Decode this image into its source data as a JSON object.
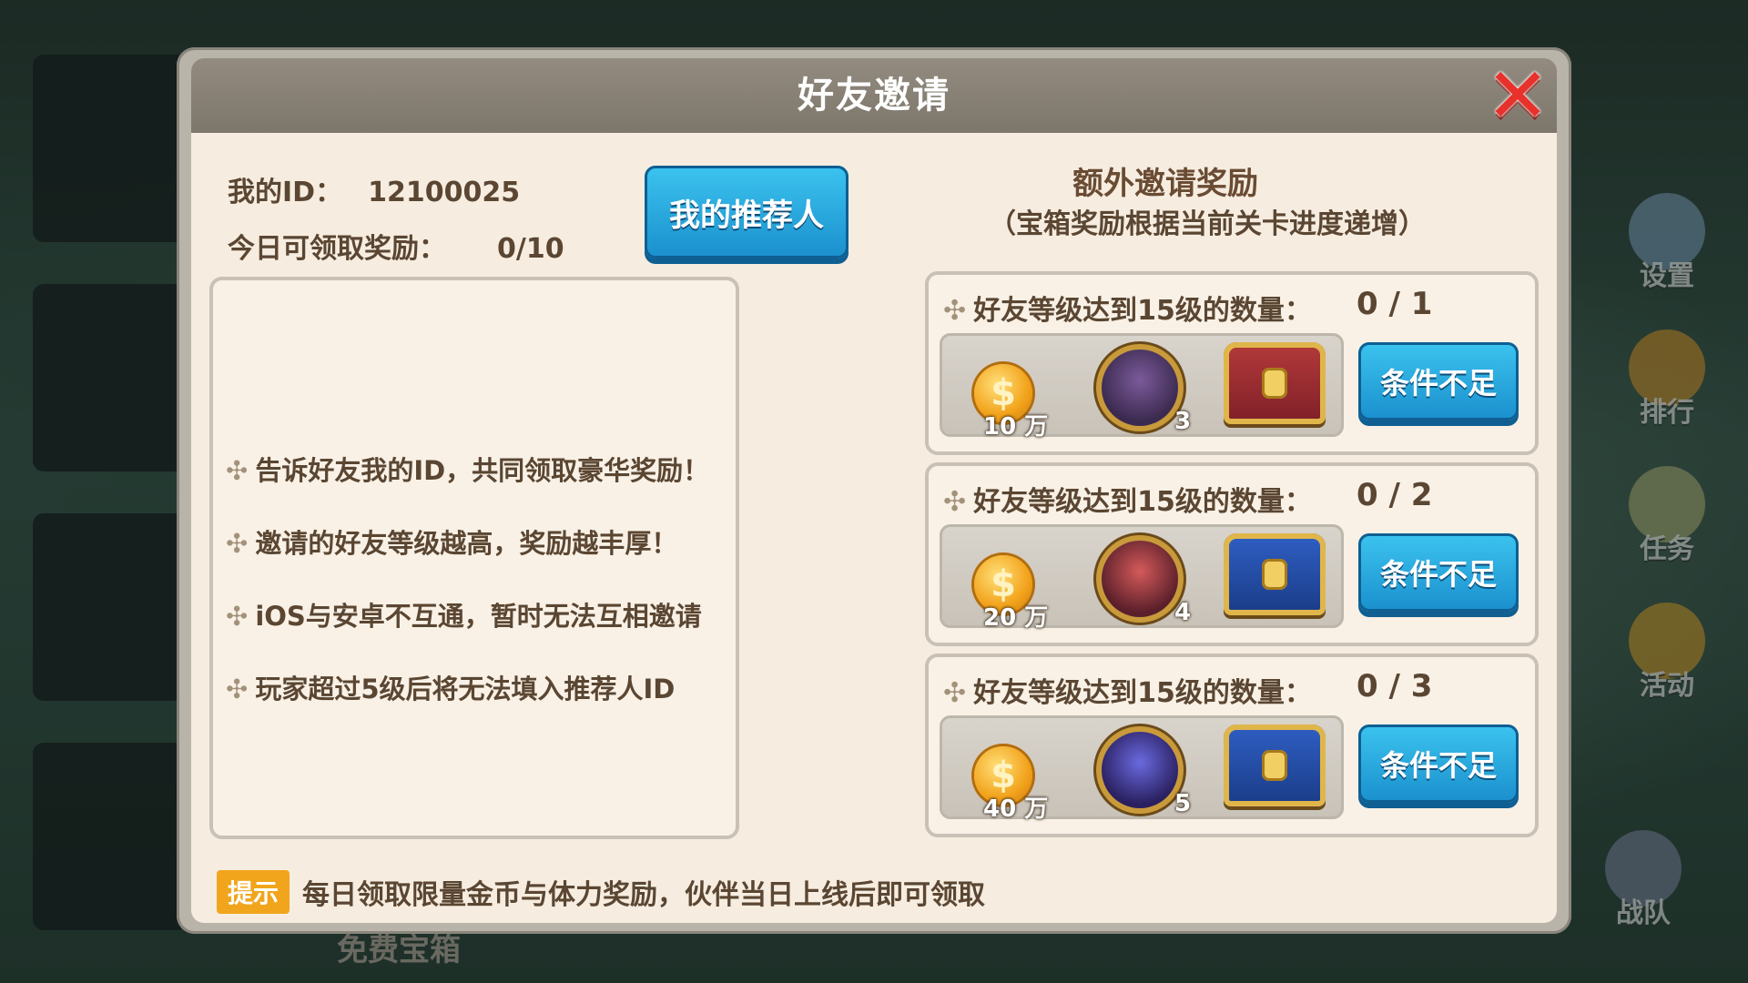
{
  "dialog": {
    "title": "好友邀请"
  },
  "info": {
    "my_id_label": "我的ID：",
    "my_id_value": "12100025",
    "today_label": "今日可领取奖励：",
    "today_value": "0/10"
  },
  "referrer_button": "我的推荐人",
  "tips": [
    "告诉好友我的ID，共同领取豪华奖励！",
    "邀请的好友等级越高，奖励越丰厚！",
    "iOS与安卓不互通，暂时无法互相邀请",
    "玩家超过5级后将无法填入推荐人ID"
  ],
  "extra": {
    "title": "额外邀请奖励",
    "subtitle": "（宝箱奖励根据当前关卡进度递增）"
  },
  "rewards": [
    {
      "requirement": "好友等级达到15级的数量：",
      "progress": "0 / 1",
      "coin": "10 万",
      "hero_stars": "3",
      "button": "条件不足"
    },
    {
      "requirement": "好友等级达到15级的数量：",
      "progress": "0 / 2",
      "coin": "20 万",
      "hero_stars": "4",
      "button": "条件不足"
    },
    {
      "requirement": "好友等级达到15级的数量：",
      "progress": "0 / 3",
      "coin": "40 万",
      "hero_stars": "5",
      "button": "条件不足"
    }
  ],
  "hint": {
    "badge": "提示",
    "text": "每日领取限量金币与体力奖励，伙伴当日上线后即可领取"
  },
  "background": {
    "side_menu": [
      "设置",
      "排行",
      "任务",
      "活动",
      "战队"
    ],
    "bottom_label": "免费宝箱"
  }
}
